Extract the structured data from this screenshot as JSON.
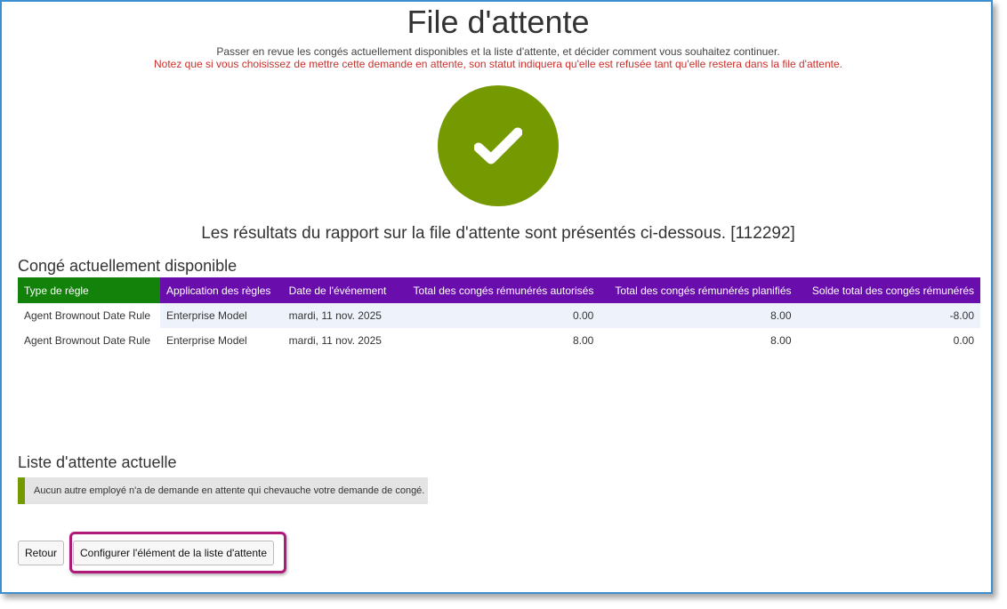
{
  "page": {
    "title": "File d'attente",
    "subtitle": "Passer en revue les congés actuellement disponibles et la liste d'attente, et décider comment vous souhaitez continuer.",
    "warning": "Notez que si vous choisissez de mettre cette demande en attente, son statut indiquera qu'elle est refusée tant qu'elle restera dans la file d'attente.",
    "results_text": "Les résultats du rapport sur la file d'attente sont présentés ci-dessous. [112292]"
  },
  "status_icon": {
    "icon": "checkmark-icon",
    "color": "#759900"
  },
  "leave_section": {
    "title": "Congé actuellement disponible",
    "columns": [
      "Type de règle",
      "Application des règles",
      "Date de l'événement",
      "Total des congés rémunérés autorisés",
      "Total des congés rémunérés planifiés",
      "Solde total des congés rémunérés"
    ],
    "rows": [
      [
        "Agent Brownout Date Rule",
        "Enterprise Model",
        "mardi, 11 nov. 2025",
        "0.00",
        "8.00",
        "-8.00"
      ],
      [
        "Agent Brownout Date Rule",
        "Enterprise Model",
        "mardi, 11 nov. 2025",
        "8.00",
        "8.00",
        "0.00"
      ]
    ],
    "header_colors": {
      "first": "#12820a",
      "rest": "#6a0dad"
    }
  },
  "waitlist_section": {
    "title": "Liste d'attente actuelle",
    "notice": "Aucun autre employé n'a de demande en attente qui chevauche votre demande de congé."
  },
  "buttons": {
    "back": "Retour",
    "configure": "Configurer l'élément de la liste d'attente"
  },
  "colors": {
    "accent": "#759900",
    "warning": "#c9302c",
    "highlight": "#b0197a",
    "frame": "#3c8fd0"
  }
}
